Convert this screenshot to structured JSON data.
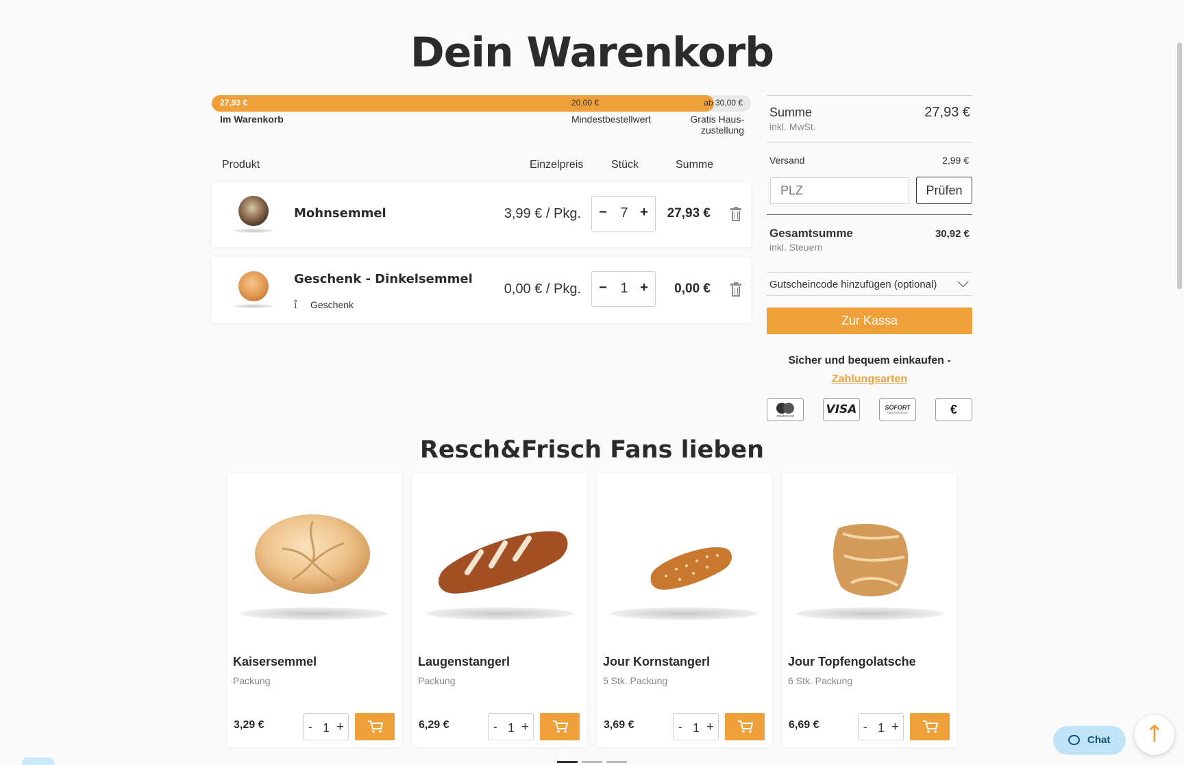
{
  "title": "Dein Warenkorb",
  "progress": {
    "fraction": 0.931,
    "current_value": "27,93 €",
    "current_label": "Im Warenkorb",
    "min_value": "20,00 €",
    "min_label": "Mindestbestellwert",
    "free_value": "ab 30,00 €",
    "free_label_1": "Gratis Haus-",
    "free_label_2": "zustellung"
  },
  "table": {
    "col_product": "Produkt",
    "col_unitprice": "Einzelpreis",
    "col_qty": "Stück",
    "col_sum": "Summe"
  },
  "items": [
    {
      "name": "Mohnsemmel",
      "unit_price": "3,99 € / Pkg.",
      "qty": "7",
      "sum": "27,93 €",
      "minus": "−",
      "plus": "+",
      "note": ""
    },
    {
      "name": "Geschenk - Dinkelsemmel",
      "unit_price": "0,00 € / Pkg.",
      "qty": "1",
      "sum": "0,00 €",
      "minus": "−",
      "plus": "+",
      "note_icon": "ı̊",
      "note": "Geschenk"
    }
  ],
  "summary": {
    "sum_label": "Summe",
    "sum_sub": "inkl. MwSt.",
    "sum_value": "27,93 €",
    "shipping_label": "Versand",
    "shipping_value": "2,99 €",
    "plz_placeholder": "PLZ",
    "check_button": "Prüfen",
    "total_label": "Gesamtsumme",
    "total_sub": "inkl. Steuern",
    "total_value": "30,92 €",
    "coupon_label": "Gutscheincode hinzufügen (optional)",
    "checkout_button": "Zur Kassa",
    "secure_text": "Sicher und bequem einkaufen -",
    "payment_link": "Zahlungsarten",
    "payment_icons": [
      "mastercard-icon",
      "visa-icon",
      "sofort-icon",
      "bank-transfer-icon"
    ],
    "mastercard_text": "mastercard",
    "visa_text": "VISA",
    "sofort_text": "SOFORT",
    "sofort_sub": "ÜBERWEISUNG",
    "transfer_symbol": "€"
  },
  "reco": {
    "title": "Resch&Frisch Fans lieben",
    "products": [
      {
        "name": "Kaisersemmel",
        "pack": "Packung",
        "price": "3,29 €",
        "qty": "1",
        "minus": "-",
        "plus": "+"
      },
      {
        "name": "Laugenstangerl",
        "pack": "Packung",
        "price": "6,29 €",
        "qty": "1",
        "minus": "-",
        "plus": "+"
      },
      {
        "name": "Jour Kornstangerl",
        "pack": "5 Stk. Packung",
        "price": "3,69 €",
        "qty": "1",
        "minus": "-",
        "plus": "+"
      },
      {
        "name": "Jour Topfengolatsche",
        "pack": "6 Stk. Packung",
        "price": "6,69 €",
        "qty": "1",
        "minus": "-",
        "plus": "+"
      }
    ]
  },
  "chat_label": "Chat",
  "to_top_symbol": "↑",
  "colors": {
    "accent": "#f0a03a",
    "text": "#2b2b2b",
    "chat_bg": "#bfe3f7"
  }
}
